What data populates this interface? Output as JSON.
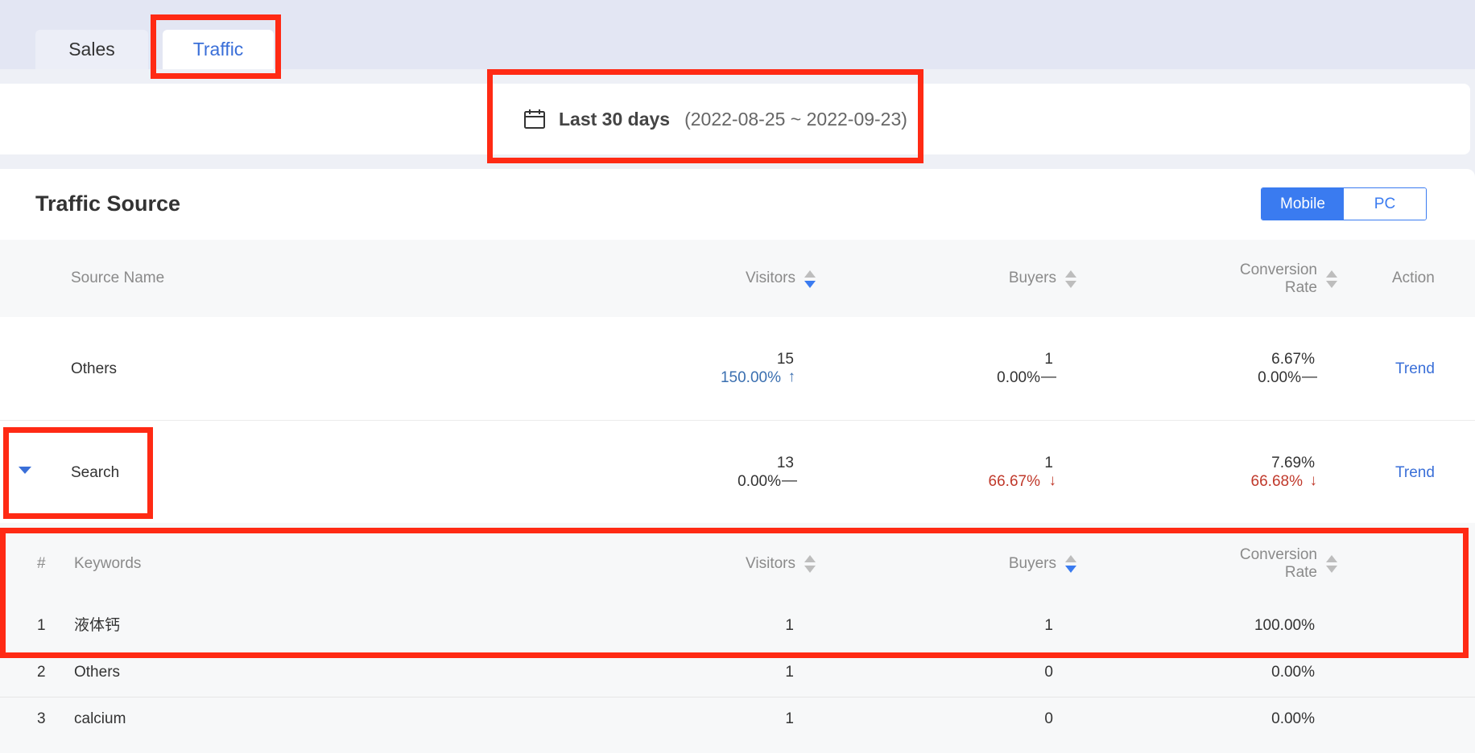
{
  "tabs": {
    "sales": "Sales",
    "traffic": "Traffic"
  },
  "date": {
    "label": "Last 30 days",
    "range": "(2022-08-25 ~ 2022-09-23)",
    "icon": "calendar-icon"
  },
  "panel": {
    "title": "Traffic Source"
  },
  "device_toggle": {
    "mobile": "Mobile",
    "pc": "PC",
    "selected": "Mobile"
  },
  "table": {
    "headers": {
      "source": "Source Name",
      "visitors": "Visitors",
      "buyers": "Buyers",
      "conv_line1": "Conversion",
      "conv_line2": "Rate",
      "action": "Action"
    },
    "rows": [
      {
        "name": "Others",
        "visitors": "15",
        "visitors_change": "150.00%",
        "visitors_trend": "↑",
        "buyers": "1",
        "buyers_change": "0.00%",
        "buyers_trend": "—",
        "conversion": "6.67%",
        "conversion_change": "0.00%",
        "conversion_trend": "—",
        "action": "Trend"
      },
      {
        "name": "Search",
        "visitors": "13",
        "visitors_change": "0.00%",
        "visitors_trend": "—",
        "buyers": "1",
        "buyers_change": "66.67%",
        "buyers_trend": "↓",
        "conversion": "7.69%",
        "conversion_change": "66.68%",
        "conversion_trend": "↓",
        "action": "Trend"
      }
    ]
  },
  "keywords": {
    "headers": {
      "index": "#",
      "keyword": "Keywords",
      "visitors": "Visitors",
      "buyers": "Buyers",
      "conv_line1": "Conversion",
      "conv_line2": "Rate"
    },
    "rows": [
      {
        "index": "1",
        "keyword": "液体钙",
        "visitors": "1",
        "buyers": "1",
        "conversion": "100.00%"
      },
      {
        "index": "2",
        "keyword": "Others",
        "visitors": "1",
        "buyers": "0",
        "conversion": "0.00%"
      },
      {
        "index": "3",
        "keyword": "calcium",
        "visitors": "1",
        "buyers": "0",
        "conversion": "0.00%"
      }
    ]
  },
  "colors": {
    "accent": "#3a7bf0",
    "highlight": "#ff2a14",
    "increase": "#3a6fb0",
    "decrease": "#c0392b"
  }
}
